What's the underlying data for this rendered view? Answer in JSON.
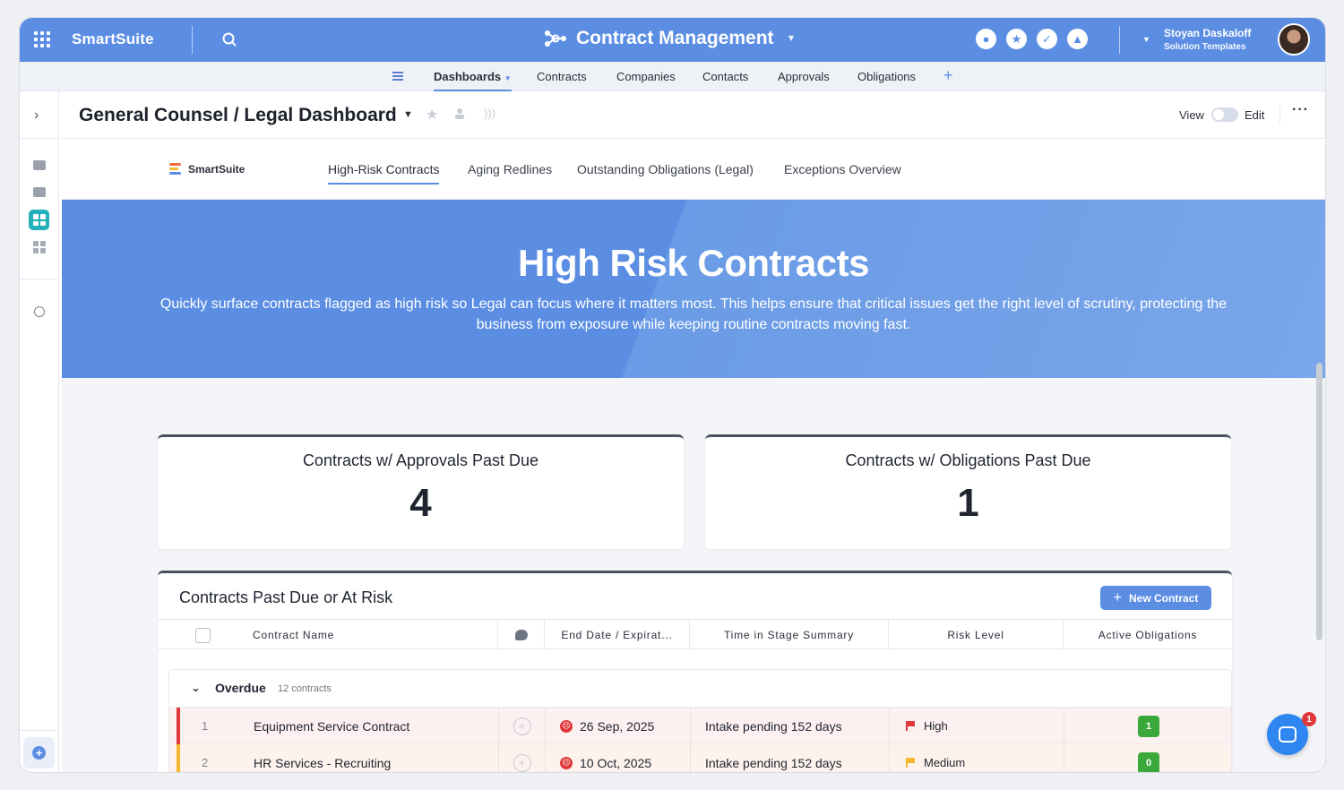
{
  "topbar": {
    "brand": "SmartSuite",
    "app_title": "Contract Management",
    "user_name": "Stoyan Daskaloff",
    "user_subtitle": "Solution Templates",
    "accent": "#5b8ee3"
  },
  "nav": {
    "items": [
      "Dashboards",
      "Contracts",
      "Companies",
      "Contacts",
      "Approvals",
      "Obligations"
    ],
    "active": "Dashboards",
    "add_label": "+"
  },
  "dashboard": {
    "title": "General Counsel / Legal Dashboard",
    "view_label": "View",
    "edit_label": "Edit"
  },
  "tabs": {
    "logo_text": "SmartSuite",
    "items": [
      "High-Risk Contracts",
      "Aging Redlines",
      "Outstanding Obligations (Legal)",
      "Exceptions Overview"
    ],
    "active": "High-Risk Contracts"
  },
  "hero": {
    "title": "High Risk Contracts",
    "description": "Quickly surface contracts flagged as high risk so Legal can focus where it matters most. This helps ensure that critical issues get the right level of scrutiny, protecting the business from exposure while keeping routine contracts moving fast."
  },
  "stats": [
    {
      "label": "Contracts w/ Approvals Past Due",
      "value": "4"
    },
    {
      "label": "Contracts w/ Obligations Past Due",
      "value": "1"
    }
  ],
  "table": {
    "title": "Contracts Past Due or At Risk",
    "new_button": "New Contract",
    "columns": {
      "name": "Contract Name",
      "end_date": "End Date / Expirat...",
      "stage": "Time in Stage Summary",
      "risk": "Risk Level",
      "obligations": "Active Obligations"
    },
    "group": {
      "name": "Overdue",
      "count": "12 contracts"
    },
    "rows": [
      {
        "num": "1",
        "name": "Equipment Service Contract",
        "end_date": "26 Sep, 2025",
        "stage": "Intake pending 152 days",
        "risk": "High",
        "risk_color": "#e0383b",
        "bar_color": "#e0383b",
        "row_bg": "#fdf0f0",
        "obligations": "1"
      },
      {
        "num": "2",
        "name": "HR Services - Recruiting",
        "end_date": "10 Oct, 2025",
        "stage": "Intake pending 152 days",
        "risk": "Medium",
        "risk_color": "#f5b82e",
        "bar_color": "#f5b82e",
        "row_bg": "#fdf3ec",
        "obligations": "0"
      }
    ]
  },
  "chat": {
    "badge": "1"
  }
}
